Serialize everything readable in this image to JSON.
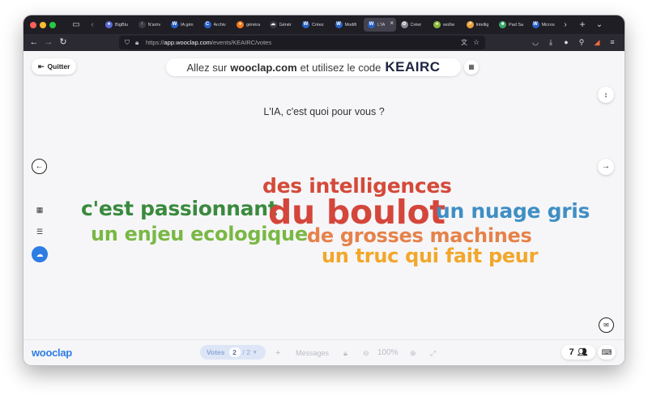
{
  "browser": {
    "tabs": [
      {
        "label": "BigBlu",
        "fav_color": "#5a6ad6",
        "fav": "●"
      },
      {
        "label": "N'arriv",
        "fav_color": "#3a3a44",
        "fav": "↑"
      },
      {
        "label": "IA gén",
        "fav_color": "#2962c7",
        "fav": "W"
      },
      {
        "label": "Archiv",
        "fav_color": "#2962c7",
        "fav": "C"
      },
      {
        "label": "généra",
        "fav_color": "#f27a1a",
        "fav": "●"
      },
      {
        "label": "Génér",
        "fav_color": "#3a3a44",
        "fav": "☁"
      },
      {
        "label": "Créez",
        "fav_color": "#2962c7",
        "fav": "W"
      },
      {
        "label": "Modifi",
        "fav_color": "#2962c7",
        "fav": "W"
      },
      {
        "label": "L'IA",
        "fav_color": "#2962c7",
        "fav": "W",
        "active": true
      },
      {
        "label": "Créer",
        "fav_color": "#8a8a92",
        "fav": "⚙"
      },
      {
        "label": "wo0w",
        "fav_color": "#8ab83a",
        "fav": "●"
      },
      {
        "label": "Intellig",
        "fav_color": "#e8a23a",
        "fav": "↗"
      },
      {
        "label": "Pad Sa",
        "fav_color": "#3aa56a",
        "fav": "■"
      },
      {
        "label": "Micros",
        "fav_color": "#2962c7",
        "fav": "W"
      }
    ],
    "url": {
      "prefix": "https://",
      "host": "app.wooclap.com",
      "path": "/events/KEAIRC/votes"
    }
  },
  "app": {
    "quit_label": "Quitter",
    "join_prefix": "Allez sur",
    "join_site": "wooclap.com",
    "join_middle": "et utilisez le code",
    "join_code": "KEAIRC",
    "question": "L'IA, c'est quoi pour vous ?",
    "logo": "wooclap",
    "votes_label": "Votes",
    "votes_current": "2",
    "votes_total": "/ 2",
    "messages_label": "Messages",
    "zoom_label": "100%",
    "participant_count": "7"
  },
  "colors": {
    "accent": "#2e7de3"
  },
  "word_cloud": [
    {
      "text": "des intelligences",
      "color": "#d44a3a",
      "size": 25
    },
    {
      "text": "c'est passionnant",
      "color": "#3a8a3e",
      "size": 25
    },
    {
      "text": "du boulot",
      "color": "#d4463b",
      "size": 41
    },
    {
      "text": "un nuage gris",
      "color": "#3f8fc4",
      "size": 25
    },
    {
      "text": "un enjeu ecologique",
      "color": "#7ab845",
      "size": 24
    },
    {
      "text": "de grosses machines",
      "color": "#e6824a",
      "size": 24
    },
    {
      "text": "un truc qui fait peur",
      "color": "#f2a72a",
      "size": 24
    }
  ]
}
